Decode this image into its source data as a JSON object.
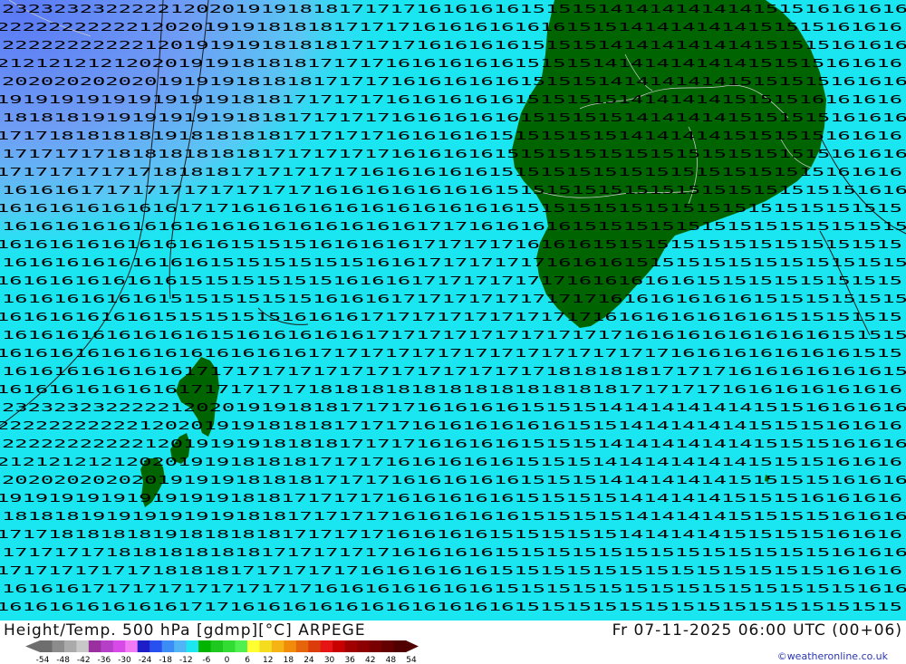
{
  "map": {
    "legend_title": "Height/Temp. 500 hPa [gdmp][°C] ARPEGE",
    "valid_time": "Fr 07-11-2025 06:00 UTC (00+06)",
    "credit": "©weatheronline.co.uk",
    "background_color": "#1ae6f2",
    "land_color": "#006400",
    "cold_colors": [
      "#5a8cf5",
      "#7aa5f5",
      "#4fd0f5"
    ],
    "label_field": [
      "2323232322222120201919181817171716161616151515141414141414151516161616",
      "2222222222212020191918181817171716161616161615151414141414151515161616",
      "2222222222212019191918181817171716161616151515141414141414151515161616",
      "2121212121202019191818181717171616161616151515141414141414151515161616",
      "2020202020201919191818181717171616161616151515141414141415151515161616",
      "1919191919191919191818171717171616161616151515151414141415151516161616",
      "1818181919191919191818171717171616161616151515151414141415151515161616",
      "1717181818181918181818171717171616161615151515151414141415151515161616",
      "1717171718181818181817171717171616161615151515151515151515151515161616",
      "1717171717171818181717171717161616161615151515151515151515151515161616",
      "1616161717171717171717171616161616161615151515151515151515151515151616",
      "1616161616161617171616161616161616161616151515151515151515151515151515",
      "1616161616161616161616161616161617171616161615151515151515151515151515",
      "1616161616161616161515151616161617171717161616151515151515151515151515",
      "1616161616161616151515151515161617171717171616161515151515151515151515",
      "1616161616161615151515151516161617171717171716161616161515151515151515",
      "1616161616161515151515151616161717171717171717161616161616151515151515",
      "1616161616161515151515161616171717171717171717161616161616161515151515",
      "1616161616161616151616161616171717171717171717171616161616161616151515",
      "1616161616161616161616161717171717171717171717171717161616161616161515",
      "1616161616161617171717171717171717171717171818181817171716161616161615",
      "1616161616161617171717171818181818181818181818181717171716161616161616"
    ],
    "label_rows": [
      2,
      22,
      42,
      62,
      82,
      102,
      122,
      142,
      162,
      182,
      202,
      222,
      242,
      262,
      282,
      302,
      322,
      342,
      362,
      382,
      402,
      422,
      442,
      462,
      482,
      502,
      522,
      542,
      562,
      582,
      602,
      622,
      642,
      662,
      682
    ]
  },
  "colorbar": {
    "ticks": [
      "-54",
      "-48",
      "-42",
      "-36",
      "-30",
      "-24",
      "-18",
      "-12",
      "-6",
      "0",
      "6",
      "12",
      "18",
      "24",
      "30",
      "36",
      "42",
      "48",
      "54"
    ],
    "colors": [
      "#6e6e6e",
      "#8c8c8c",
      "#aaaaaa",
      "#c8c8c8",
      "#9a2fa0",
      "#b63fc8",
      "#d84ae8",
      "#f27af5",
      "#1e1ec8",
      "#2850f0",
      "#3c8cf5",
      "#50b4f5",
      "#1ee6f0",
      "#00b400",
      "#1ec81e",
      "#32dc32",
      "#50f050",
      "#ffff32",
      "#f5dc1e",
      "#f5b414",
      "#f08c0a",
      "#e6640a",
      "#dc3c0a",
      "#e61414",
      "#c80000",
      "#a00000",
      "#8c0000",
      "#780000",
      "#640000",
      "#500000"
    ]
  }
}
